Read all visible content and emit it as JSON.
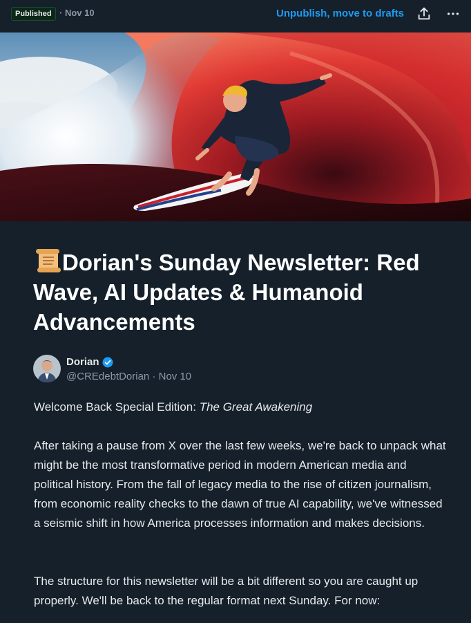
{
  "topbar": {
    "status_badge": "Published",
    "date": "· Nov 10",
    "unpublish_label": "Unpublish, move to drafts",
    "share_icon": "share-upload-icon",
    "more_icon": "more-horizontal-icon"
  },
  "hero": {
    "icon": "hero-image-surfer-red-wave"
  },
  "article": {
    "title_text": "Dorian's Sunday Newsletter: Red Wave, AI Updates & Humanoid Advancements",
    "title_icon": "scroll-icon",
    "author": {
      "name": "Dorian",
      "handle_date": "@CREdebtDorian · Nov 10",
      "verified_icon": "verified-badge-icon"
    },
    "intro_plain": "Welcome Back Special Edition: ",
    "intro_italic": "The Great Awakening",
    "paragraph_2": "After taking a pause from X over the last few weeks, we're back to unpack what might be the most transformative period in modern American media and political history. From the fall of legacy media to the rise of citizen journalism, from economic reality checks to the dawn of true AI capability, we've witnessed a seismic shift in how America processes information and makes decisions.",
    "paragraph_3": "The structure for this newsletter will be a bit different so you are caught up properly. We'll be back to the regular format next Sunday. For now:"
  },
  "colors": {
    "background": "#15202b",
    "accent": "#1d9bf0",
    "muted": "#8b98a5",
    "text": "#e7e9ea"
  }
}
